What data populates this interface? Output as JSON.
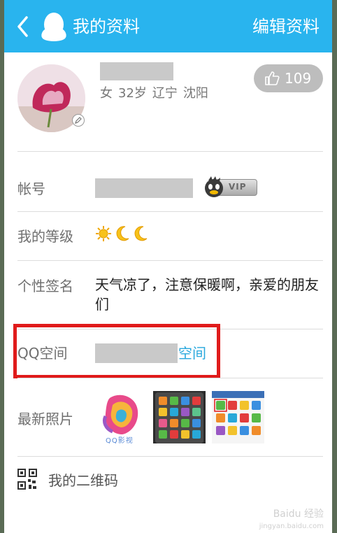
{
  "header": {
    "title": "我的资料",
    "edit_label": "编辑资料",
    "back_icon": "chevron-left-icon",
    "logo_icon": "qq-penguin-icon",
    "background_color": "#29b4ee"
  },
  "profile": {
    "gender": "女",
    "age": "32岁",
    "province": "辽宁",
    "city": "沈阳",
    "likes": "109",
    "like_icon": "thumbs-up-icon"
  },
  "rows": {
    "account": {
      "label": "帐号",
      "badge": "VIP"
    },
    "level": {
      "label": "我的等级",
      "icons": [
        "sun-icon",
        "moon-icon",
        "moon-icon"
      ]
    },
    "signature": {
      "label": "个性签名",
      "value": "天气凉了，注意保暖啊，亲爱的朋友们"
    },
    "qzone": {
      "label": "QQ空间",
      "link": "空间"
    },
    "photos": {
      "label": "最新照片",
      "photo_caption": "QQ影视"
    },
    "qrcode": {
      "label": "我的二维码",
      "icon": "qr-code-icon"
    }
  },
  "watermark": {
    "text": "Baidu 经验",
    "url": "jingyan.baidu.com"
  },
  "colors": {
    "accent": "#29b4ee",
    "link": "#29a8dd",
    "highlight": "#e01b1b"
  }
}
